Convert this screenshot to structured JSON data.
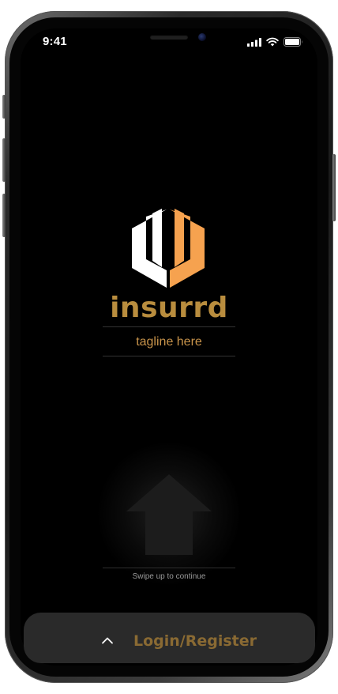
{
  "status_bar": {
    "time": "9:41",
    "icons": [
      "cellular-signal-icon",
      "wifi-icon",
      "battery-icon"
    ]
  },
  "brand": {
    "name": "insurrd",
    "tagline": "tagline here",
    "logo_icon": "insurrd-logo-icon",
    "colors": {
      "name": "#b98d3e",
      "tagline": "#c9944b",
      "logo_white": "#ffffff",
      "logo_orange": "#f6a24f"
    }
  },
  "swipe_hint": {
    "text": "Swipe up to continue",
    "icon": "arrow-up-icon"
  },
  "login_sheet": {
    "label": "Login/Register",
    "icon": "chevron-up-icon",
    "label_color": "#8a6a33",
    "background": "#2a2a2a"
  }
}
